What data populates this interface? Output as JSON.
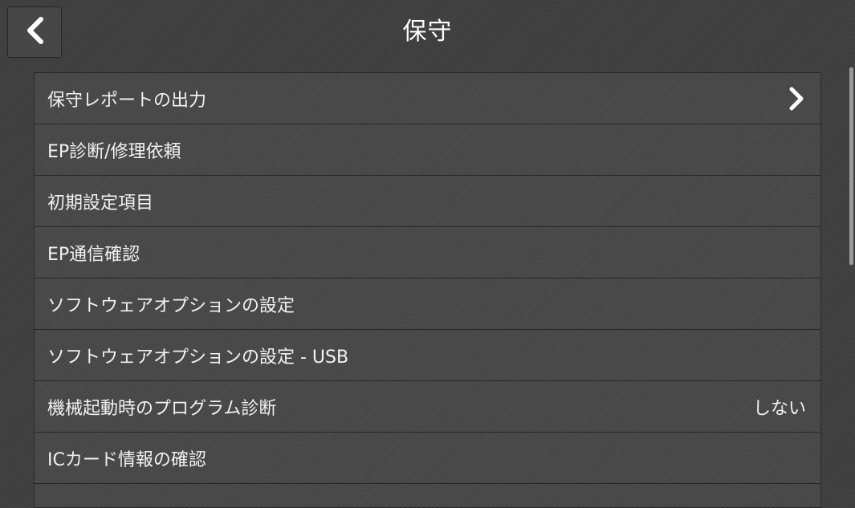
{
  "header": {
    "title": "保守",
    "back_icon": "chevron-left-icon"
  },
  "menu": {
    "items": [
      {
        "label": "保守レポートの出力",
        "value": "",
        "icon": "chevron-right-icon"
      },
      {
        "label": "EP診断/修理依頼",
        "value": ""
      },
      {
        "label": "初期設定項目",
        "value": ""
      },
      {
        "label": "EP通信確認",
        "value": ""
      },
      {
        "label": "ソフトウェアオプションの設定",
        "value": ""
      },
      {
        "label": "ソフトウェアオプションの設定 - USB",
        "value": ""
      },
      {
        "label": "機械起動時のプログラム診断",
        "value": "しない"
      },
      {
        "label": "ICカード情報の確認",
        "value": ""
      }
    ]
  },
  "colors": {
    "background": "#3e3e3e",
    "row": "#474747",
    "text": "#f2f2f2",
    "divider": "#272727"
  }
}
